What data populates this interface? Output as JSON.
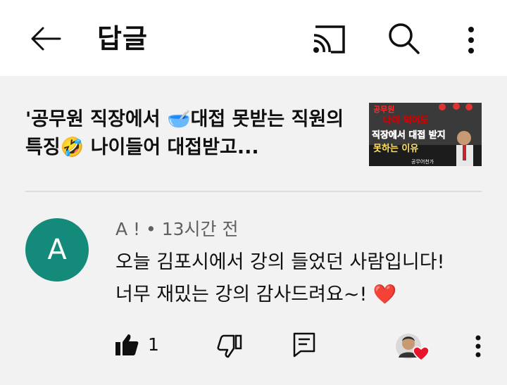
{
  "appbar": {
    "title": "답글"
  },
  "video": {
    "title": "'공무원 직장에서 🥣대접 못받는 직원의 특징🤣 나이들어 대접받고...",
    "thumbnail": {
      "lines": [
        "공무원",
        "나이 먹어도",
        "직장에서 대접 받지",
        "못하는 이유"
      ],
      "caption": "공무어천가"
    }
  },
  "comment": {
    "avatar_letter": "A",
    "author": "A !",
    "separator": "•",
    "time": "13시간 전",
    "text_line1": "오늘 김포시에서 강의 들었던 사람입니다!",
    "text_line2": "너무 재밌는 강의 감사드려요~! ❤️",
    "like_count": "1"
  },
  "colors": {
    "avatar_bg": "#148a7a",
    "heart": "#e8152c"
  }
}
